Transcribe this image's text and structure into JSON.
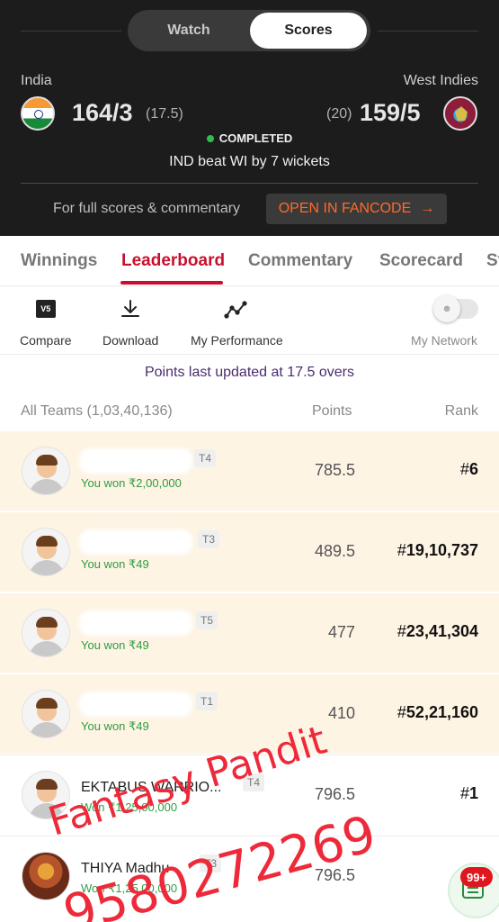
{
  "toggle": {
    "watch": "Watch",
    "scores": "Scores",
    "selected": "Scores"
  },
  "match": {
    "team1": {
      "name": "India",
      "score": "164/3",
      "overs": "(17.5)"
    },
    "team2": {
      "name": "West Indies",
      "score": "159/5",
      "overs": "(20)"
    },
    "status": "COMPLETED",
    "result": "IND beat WI by 7 wickets"
  },
  "fancode": {
    "text": "For full scores & commentary",
    "button": "OPEN IN FANCODE",
    "arrow": "→"
  },
  "tabs": [
    {
      "label": "Winnings",
      "active": false
    },
    {
      "label": "Leaderboard",
      "active": true
    },
    {
      "label": "Commentary",
      "active": false
    },
    {
      "label": "Scorecard",
      "active": false
    },
    {
      "label": "St",
      "active": false
    }
  ],
  "actions": {
    "compare": {
      "label": "Compare",
      "icon": "vs-icon",
      "icon_text": "V5"
    },
    "download": {
      "label": "Download",
      "icon": "download-icon"
    },
    "performance": {
      "label": "My Performance",
      "icon": "performance-chart-icon"
    },
    "network": {
      "label": "My Network",
      "icon": "users-icon",
      "enabled": false
    }
  },
  "updated": "Points last updated at 17.5 overs",
  "list_header": {
    "teams": "All Teams (1,03,40,136)",
    "points": "Points",
    "rank": "Rank"
  },
  "rows": [
    {
      "name": "",
      "tag": "T4",
      "won": "You won ₹2,00,000",
      "points": "785.5",
      "hash": "#",
      "rank": "6",
      "mine": true
    },
    {
      "name": "",
      "tag": "T3",
      "won": "You won ₹49",
      "points": "489.5",
      "hash": "#",
      "rank": "19,10,737",
      "mine": true
    },
    {
      "name": "",
      "tag": "T5",
      "won": "You won ₹49",
      "points": "477",
      "hash": "#",
      "rank": "23,41,304",
      "mine": true
    },
    {
      "name": "",
      "tag": "T1",
      "won": "You won ₹49",
      "points": "410",
      "hash": "#",
      "rank": "52,21,160",
      "mine": true
    },
    {
      "name": "EKTABUS WARRIO...",
      "tag": "T4",
      "won": "Won ₹1,25,00,000",
      "points": "796.5",
      "hash": "#",
      "rank": "1",
      "mine": false
    },
    {
      "name": "THIYA Madhu",
      "tag": "T3",
      "won": "Won ₹1,25,00,000",
      "points": "796.5",
      "hash": "",
      "rank": "",
      "mine": false
    }
  ],
  "watermark": {
    "line1": "Fantasy Pandit",
    "line2": "9580272269"
  },
  "chat": {
    "badge": "99+",
    "icon": "chat-icon"
  },
  "colors": {
    "accent": "#c8102e",
    "fancode": "#ff6a2b",
    "won": "#2f9d42",
    "highlight_row": "#fdf4e4",
    "watermark": "#ee2a3a"
  }
}
